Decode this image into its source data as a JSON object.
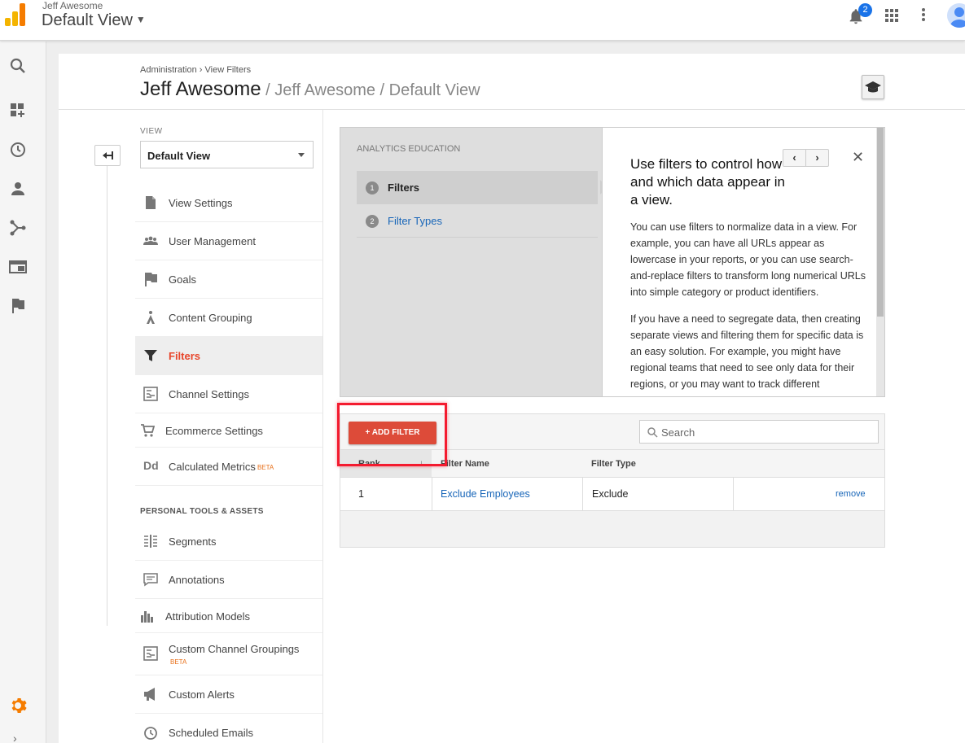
{
  "header": {
    "account_name": "Jeff Awesome",
    "view_name": "Default View",
    "notification_count": "2"
  },
  "breadcrumb": {
    "parent": "Administration",
    "separator": "›",
    "current": "View Filters"
  },
  "page_title": {
    "main": "Jeff Awesome",
    "sub": " / Jeff Awesome / Default View"
  },
  "view_selector": {
    "label": "VIEW",
    "value": "Default View"
  },
  "nav": {
    "items": [
      {
        "label": "View Settings",
        "icon": "document-icon"
      },
      {
        "label": "User Management",
        "icon": "users-icon"
      },
      {
        "label": "Goals",
        "icon": "flag-icon"
      },
      {
        "label": "Content Grouping",
        "icon": "person-walk-icon"
      },
      {
        "label": "Filters",
        "icon": "funnel-icon",
        "active": true
      },
      {
        "label": "Channel Settings",
        "icon": "channel-icon"
      },
      {
        "label": "Ecommerce Settings",
        "icon": "cart-icon"
      },
      {
        "label": "Calculated Metrics",
        "icon": "dd-icon",
        "badge": "BETA"
      }
    ],
    "personal_section_title": "PERSONAL TOOLS & ASSETS",
    "personal_items": [
      {
        "label": "Segments",
        "icon": "segments-icon"
      },
      {
        "label": "Annotations",
        "icon": "comment-icon"
      },
      {
        "label": "Attribution Models",
        "icon": "bar-chart-icon"
      },
      {
        "label": "Custom Channel Groupings",
        "icon": "channel-icon",
        "badge": "BETA"
      },
      {
        "label": "Custom Alerts",
        "icon": "megaphone-icon"
      },
      {
        "label": "Scheduled Emails",
        "icon": "clock-icon"
      }
    ]
  },
  "education": {
    "title": "ANALYTICS EDUCATION",
    "steps": [
      {
        "num": "1",
        "label": "Filters"
      },
      {
        "num": "2",
        "label": "Filter Types"
      }
    ],
    "heading": "Use filters to control how and which data appear in a view.",
    "pager_prev": "‹",
    "pager_next": "›",
    "close": "✕",
    "paragraphs": [
      "You can use filters to normalize data in a view. For example, you can have all URLs appear as lowercase in your reports, or you can use search-and-replace filters to transform long numerical URLs into simple category or product identifiers.",
      "If you have a need to segregate data, then creating separate views and filtering them for specific data is an easy solution. For example, you might have regional teams that need to see only data for their regions, or you may want to track different"
    ]
  },
  "filters_table": {
    "add_button": "+ ADD FILTER",
    "search_placeholder": "Search",
    "columns": [
      "Rank",
      "Filter Name",
      "Filter Type"
    ],
    "sort_indicator": "↓",
    "rows": [
      {
        "rank": "1",
        "name": "Exclude Employees",
        "type": "Exclude",
        "action": "remove"
      }
    ]
  },
  "colors": {
    "accent_red": "#dd4b39",
    "active_nav": "#e8462b",
    "link": "#1765b8",
    "beta": "#e8711b",
    "highlight": "#f41b2f"
  }
}
